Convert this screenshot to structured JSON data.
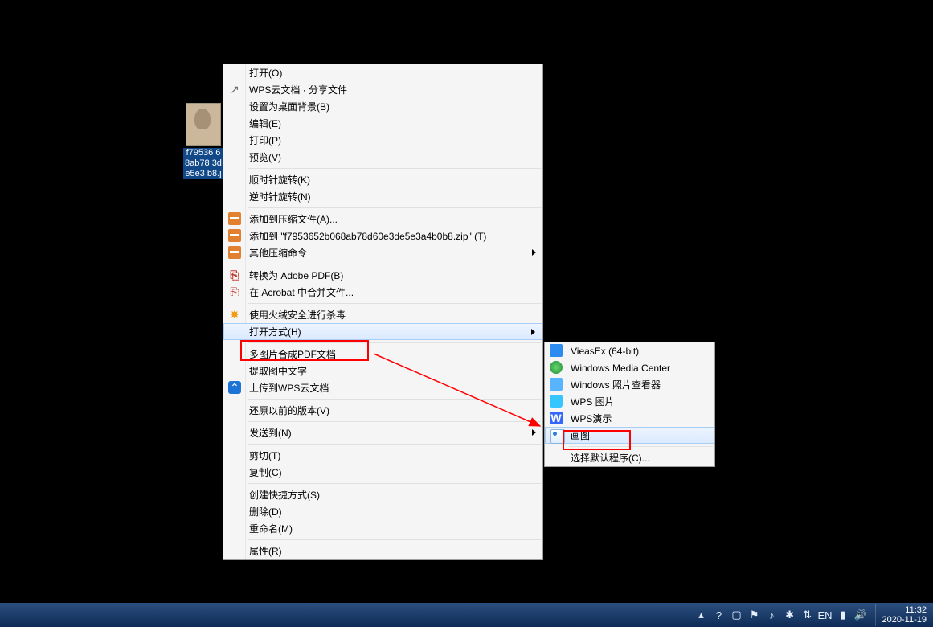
{
  "file_icon": {
    "caption": "f79536\n68ab78\n3de5e3\nb8.j"
  },
  "ctx_main": [
    {
      "type": "item",
      "label": "打开(O)"
    },
    {
      "type": "item",
      "label": "WPS云文档 · 分享文件",
      "icon": "share"
    },
    {
      "type": "item",
      "label": "设置为桌面背景(B)"
    },
    {
      "type": "item",
      "label": "编辑(E)"
    },
    {
      "type": "item",
      "label": "打印(P)"
    },
    {
      "type": "item",
      "label": "预览(V)"
    },
    {
      "type": "sep"
    },
    {
      "type": "item",
      "label": "顺时针旋转(K)"
    },
    {
      "type": "item",
      "label": "逆时针旋转(N)"
    },
    {
      "type": "sep"
    },
    {
      "type": "item",
      "label": "添加到压缩文件(A)...",
      "icon": "rar"
    },
    {
      "type": "item",
      "label": "添加到 \"f7953652b068ab78d60e3de5e3a4b0b8.zip\" (T)",
      "icon": "rar"
    },
    {
      "type": "item",
      "label": "其他压缩命令",
      "icon": "rar",
      "sub": true
    },
    {
      "type": "sep"
    },
    {
      "type": "item",
      "label": "转换为 Adobe PDF(B)",
      "icon": "pdf"
    },
    {
      "type": "item",
      "label": "在 Acrobat 中合并文件...",
      "icon": "acro"
    },
    {
      "type": "sep"
    },
    {
      "type": "item",
      "label": "使用火绒安全进行杀毒",
      "icon": "fire"
    },
    {
      "type": "item",
      "label": "打开方式(H)",
      "sub": true,
      "hl": true,
      "red": true
    },
    {
      "type": "sep"
    },
    {
      "type": "item",
      "label": "多图片合成PDF文档"
    },
    {
      "type": "item",
      "label": "提取图中文字"
    },
    {
      "type": "item",
      "label": "上传到WPS云文档",
      "icon": "cloud"
    },
    {
      "type": "sep"
    },
    {
      "type": "item",
      "label": "还原以前的版本(V)"
    },
    {
      "type": "sep"
    },
    {
      "type": "item",
      "label": "发送到(N)",
      "sub": true
    },
    {
      "type": "sep"
    },
    {
      "type": "item",
      "label": "剪切(T)"
    },
    {
      "type": "item",
      "label": "复制(C)"
    },
    {
      "type": "sep"
    },
    {
      "type": "item",
      "label": "创建快捷方式(S)"
    },
    {
      "type": "item",
      "label": "删除(D)"
    },
    {
      "type": "item",
      "label": "重命名(M)"
    },
    {
      "type": "sep"
    },
    {
      "type": "item",
      "label": "属性(R)"
    }
  ],
  "ctx_sub": [
    {
      "type": "item",
      "label": "VieasEx (64-bit)",
      "icon": "vie"
    },
    {
      "type": "item",
      "label": "Windows Media Center",
      "icon": "wmc"
    },
    {
      "type": "item",
      "label": "Windows 照片查看器",
      "icon": "wpv"
    },
    {
      "type": "item",
      "label": "WPS 图片",
      "icon": "wpsp"
    },
    {
      "type": "item",
      "label": "WPS演示",
      "icon": "wpsy"
    },
    {
      "type": "item",
      "label": "画图",
      "icon": "paint",
      "hl": true,
      "red": true
    },
    {
      "type": "sep"
    },
    {
      "type": "item",
      "label": "选择默认程序(C)..."
    }
  ],
  "taskbar": {
    "tray_icons": [
      "tray-up",
      "help",
      "screen",
      "flag",
      "audio",
      "guard",
      "network",
      "lang",
      "battery",
      "sound"
    ],
    "time": "11:32",
    "date": "2020-11-19"
  }
}
